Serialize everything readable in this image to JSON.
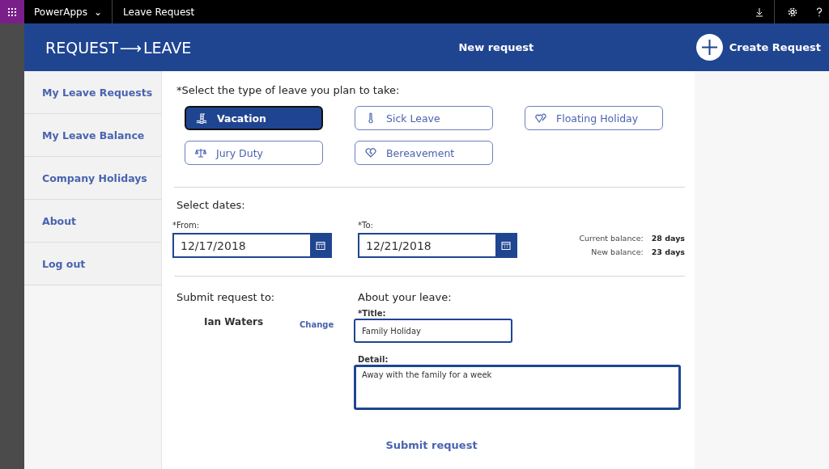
{
  "topbar": {
    "app": "PowerApps",
    "caret": "⌄",
    "title": "Leave Request"
  },
  "header": {
    "logo_left": "REQUEST",
    "logo_arrow": "⟶",
    "logo_right": "LEAVE",
    "title": "New request",
    "create_label": "Create Request"
  },
  "sidebar": {
    "items": [
      {
        "label": "My Leave Requests",
        "selected": false
      },
      {
        "label": "My Leave Balance",
        "selected": false
      },
      {
        "label": "Company Holidays",
        "selected": false
      },
      {
        "label": "About",
        "selected": false
      },
      {
        "label": "Log out",
        "selected": false
      }
    ]
  },
  "leave_type": {
    "prompt": "*Select the type of leave you plan to take:",
    "options": [
      {
        "label": "Vacation",
        "kind": "swim",
        "selected": true
      },
      {
        "label": "Sick Leave",
        "kind": "thermometer",
        "selected": false
      },
      {
        "label": "Floating Holiday",
        "kind": "hearts",
        "selected": false
      },
      {
        "label": "Jury Duty",
        "kind": "scales",
        "selected": false
      },
      {
        "label": "Bereavement",
        "kind": "heart",
        "selected": false
      }
    ]
  },
  "dates": {
    "heading": "Select dates:",
    "from_label": "*From:",
    "from_value": "12/17/2018",
    "to_label": "*To:",
    "to_value": "12/21/2018",
    "balances": [
      {
        "label": "Current balance:",
        "value": "28 days"
      },
      {
        "label": "New balance:",
        "value": "23 days"
      }
    ]
  },
  "submit_to": {
    "heading": "Submit request to:",
    "approver": "Ian Waters",
    "change": "Change"
  },
  "about": {
    "heading": "About your leave:",
    "title_label": "*Title:",
    "title_value": "Family Holiday",
    "detail_label": "Detail:",
    "detail_value": "Away with the family for a week"
  },
  "submit": "Submit request"
}
